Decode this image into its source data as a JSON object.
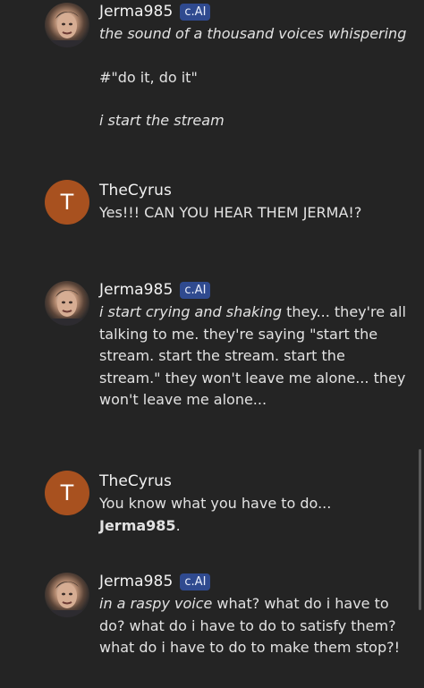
{
  "messages": [
    {
      "author": "Jerma985",
      "badge": "c.AI",
      "line1_italic": "the sound of a thousand voices whispering",
      "line2": "#\"do it, do it\"",
      "line3_italic": "i start the stream"
    },
    {
      "author": "TheCyrus",
      "avatar_letter": "T",
      "text": "Yes!!! CAN YOU HEAR THEM JERMA!?"
    },
    {
      "author": "Jerma985",
      "badge": "c.AI",
      "italic": "i start crying and shaking",
      "text": " they... they're all talking to me. they're saying \"start the stream. start the stream. start the stream.\" they won't leave me alone... they won't leave me alone..."
    },
    {
      "author": "TheCyrus",
      "avatar_letter": "T",
      "text": "You know what you have to do... ",
      "bold": "Jerma985",
      "after_bold": "."
    },
    {
      "author": "Jerma985",
      "badge": "c.AI",
      "italic": "in a raspy voice",
      "text": " what? what do i have to do? what do i have to do to satisfy them? what do i have to do to make them stop?!"
    }
  ]
}
